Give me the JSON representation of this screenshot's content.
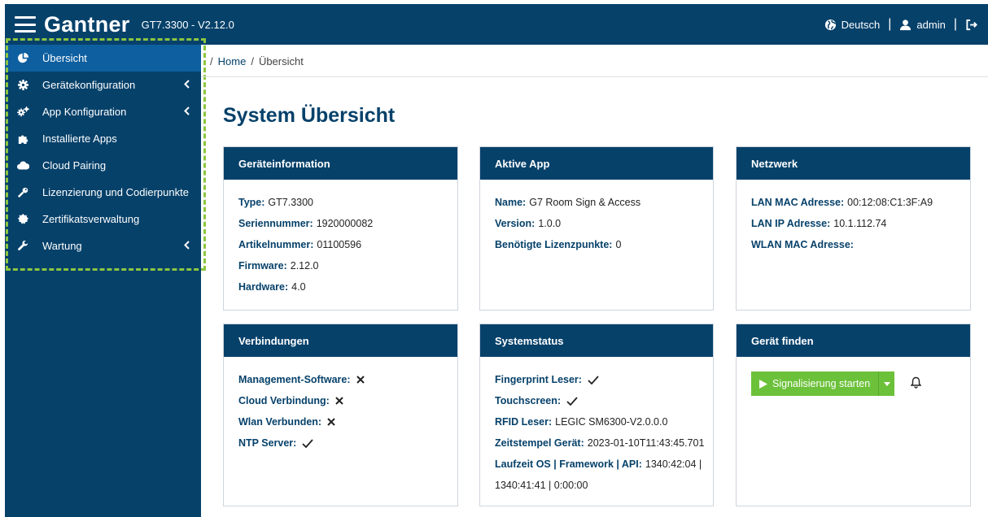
{
  "header": {
    "brand": "Gantner",
    "version": "GT7.3300 - V2.12.0",
    "language": "Deutsch",
    "user": "admin",
    "icons": [
      "menu-icon",
      "globe-icon",
      "user-icon",
      "logout-icon"
    ]
  },
  "sidebar": {
    "items": [
      {
        "label": "Übersicht",
        "icon": "pie-chart-icon",
        "active": true
      },
      {
        "label": "Gerätekonfiguration",
        "icon": "gear-icon",
        "submenu": true
      },
      {
        "label": "App Konfiguration",
        "icon": "gears-icon",
        "submenu": true
      },
      {
        "label": "Installierte Apps",
        "icon": "puzzle-icon"
      },
      {
        "label": "Cloud Pairing",
        "icon": "cloud-icon"
      },
      {
        "label": "Lizenzierung und Codierpunkte",
        "icon": "key-icon"
      },
      {
        "label": "Zertifikatsverwaltung",
        "icon": "certificate-icon"
      },
      {
        "label": "Wartung",
        "icon": "wrench-icon",
        "submenu": true
      }
    ]
  },
  "breadcrumb": {
    "sep": "/",
    "home": "Home",
    "current": "Übersicht"
  },
  "page": {
    "title": "System Übersicht"
  },
  "cards": {
    "device": {
      "title": "Geräteinformation",
      "rows": [
        {
          "k": "Type:",
          "v": "GT7.3300"
        },
        {
          "k": "Seriennummer:",
          "v": "1920000082"
        },
        {
          "k": "Artikelnummer:",
          "v": "01100596"
        },
        {
          "k": "Firmware:",
          "v": "2.12.0"
        },
        {
          "k": "Hardware:",
          "v": "4.0"
        }
      ]
    },
    "app": {
      "title": "Aktive App",
      "rows": [
        {
          "k": "Name:",
          "v": "G7 Room Sign & Access"
        },
        {
          "k": "Version:",
          "v": "1.0.0"
        },
        {
          "k": "Benötigte Lizenzpunkte:",
          "v": "0"
        }
      ]
    },
    "network": {
      "title": "Netzwerk",
      "rows": [
        {
          "k": "LAN MAC Adresse:",
          "v": "00:12:08:C1:3F:A9"
        },
        {
          "k": "LAN IP Adresse:",
          "v": "10.1.112.74"
        },
        {
          "k": "WLAN MAC Adresse:",
          "v": ""
        }
      ]
    },
    "connections": {
      "title": "Verbindungen",
      "rows": [
        {
          "k": "Management-Software:",
          "status": "cross"
        },
        {
          "k": "Cloud Verbindung:",
          "status": "cross"
        },
        {
          "k": "Wlan Verbunden:",
          "status": "cross"
        },
        {
          "k": "NTP Server:",
          "status": "check"
        }
      ]
    },
    "status": {
      "title": "Systemstatus",
      "rows": [
        {
          "k": "Fingerprint Leser:",
          "status": "check"
        },
        {
          "k": "Touchscreen:",
          "status": "check"
        },
        {
          "k": "RFID Leser:",
          "v": "LEGIC SM6300-V2.0.0.0"
        },
        {
          "k": "Zeitstempel Gerät:",
          "v": "2023-01-10T11:43:45.701"
        },
        {
          "k": "Laufzeit OS | Framework | API:",
          "v": "1340:42:04 |"
        },
        {
          "k": "",
          "v": "1340:41:41 | 0:00:00"
        }
      ]
    },
    "find": {
      "title": "Gerät finden",
      "button": "Signalisierung starten",
      "icons": [
        "play-icon",
        "caret-down-icon",
        "bell-icon"
      ]
    }
  },
  "colors": {
    "primary": "#06416a",
    "active": "#0e5fa0",
    "success": "#6cc13a",
    "highlight": "#8cc63f"
  }
}
